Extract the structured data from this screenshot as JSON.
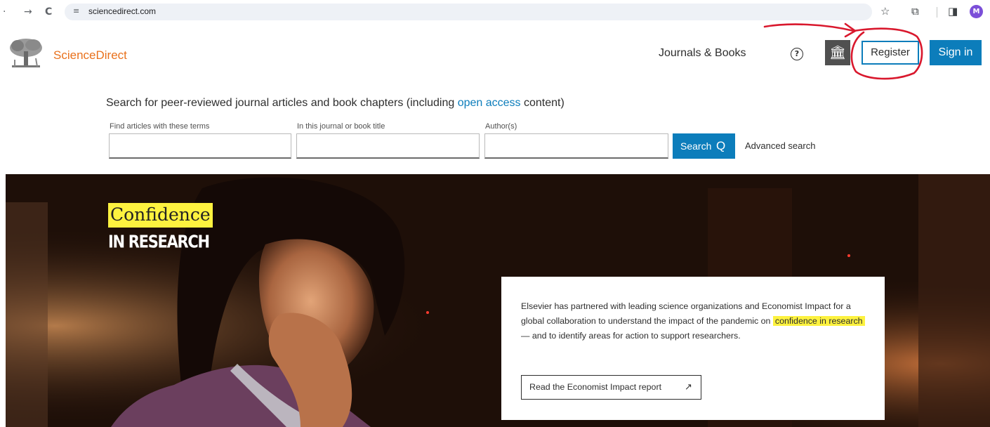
{
  "browser": {
    "back_icon": "·",
    "forward_icon": "→",
    "reload_icon": "C",
    "site_settings_icon": "≡",
    "url": "sciencedirect.com",
    "bookmark_icon": "☆",
    "extensions_icon": "⧉",
    "sidepanel_icon": "◨",
    "profile_initial": "M"
  },
  "header": {
    "brand": "ScienceDirect",
    "journals_books": "Journals & Books",
    "help_icon": "?",
    "institution_icon": "🏛",
    "register": "Register",
    "sign_in": "Sign in",
    "annotation_color": "#d9182d"
  },
  "search": {
    "intro_before": "Search for peer-reviewed journal articles and book chapters (including ",
    "intro_link": "open access",
    "intro_after": " content)",
    "field_terms_label": "Find articles with these terms",
    "field_journal_label": "In this journal or book title",
    "field_author_label": "Author(s)",
    "field_terms_value": "",
    "field_journal_value": "",
    "field_author_value": "",
    "search_button": "Search",
    "search_icon": "Q",
    "advanced": "Advanced search"
  },
  "hero": {
    "title": "Confidence",
    "subtitle": "IN RESEARCH",
    "text_before": "Elsevier has partnered with leading science organizations and Economist Impact for a global collaboration to understand the impact of the pandemic on ",
    "text_highlight": "confidence in research",
    "text_after": " — and to identify areas for action to support researchers.",
    "report_button": "Read the Economist Impact report",
    "report_arrow": "↗"
  },
  "colors": {
    "brand_orange": "#e9711c",
    "primary_blue": "#0c7dbb",
    "highlight_yellow": "#fdf23f"
  }
}
